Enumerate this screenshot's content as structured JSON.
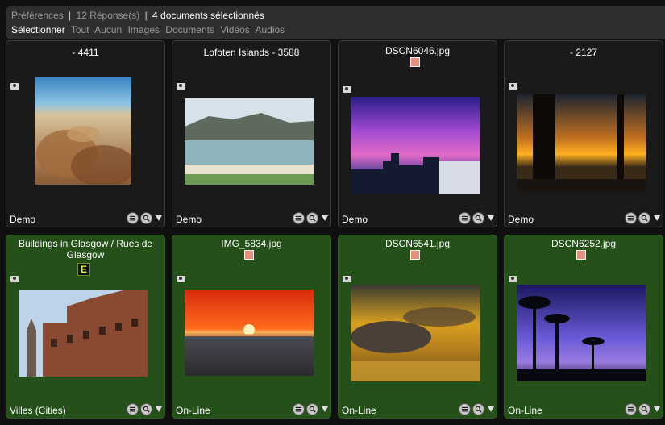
{
  "header": {
    "preferences_label": "Préférences",
    "sep1": "|",
    "responses_label": "12 Réponse(s)",
    "sep2": "|",
    "selected_label": "4 documents sélectionnés",
    "select_label": "Sélectionner",
    "options": [
      "Tout",
      "Aucun",
      "Images",
      "Documents",
      "Vidéos",
      "Audios"
    ]
  },
  "colors": {
    "selected_card": "#255019",
    "unselected_card": "#1a1a1a",
    "status_swatch": "#e58f80",
    "badge_text": "#d8f025"
  },
  "cards": [
    {
      "title": "- 4411",
      "label": "Demo",
      "selected": false,
      "has_swatch": false,
      "image": "sandy-beach-photo"
    },
    {
      "title": "Lofoten Islands - 3588",
      "label": "Demo",
      "selected": false,
      "has_swatch": false,
      "image": "coastline-photo"
    },
    {
      "title": "DSCN6046.jpg",
      "label": "Demo",
      "selected": false,
      "has_swatch": true,
      "image": "pink-sky-city-photo"
    },
    {
      "title": "- 2127",
      "label": "Demo",
      "selected": false,
      "has_swatch": false,
      "image": "palm-sunset-photo"
    },
    {
      "title": "Buildings in Glasgow / Rues de Glasgow",
      "label": "Villes (Cities)",
      "selected": true,
      "has_swatch": false,
      "badge": "E",
      "image": "glasgow-buildings-photo"
    },
    {
      "title": "IMG_5834.jpg",
      "label": "On-Line",
      "selected": true,
      "has_swatch": true,
      "image": "red-sea-sunset-photo"
    },
    {
      "title": "DSCN6541.jpg",
      "label": "On-Line",
      "selected": true,
      "has_swatch": true,
      "image": "golden-clouds-photo"
    },
    {
      "title": "DSCN6252.jpg",
      "label": "On-Line",
      "selected": true,
      "has_swatch": true,
      "image": "purple-palms-photo"
    }
  ],
  "icons": {
    "camera": "camera-icon",
    "details": "details-icon",
    "zoom": "zoom-icon",
    "menu": "dropdown-arrow-icon"
  }
}
